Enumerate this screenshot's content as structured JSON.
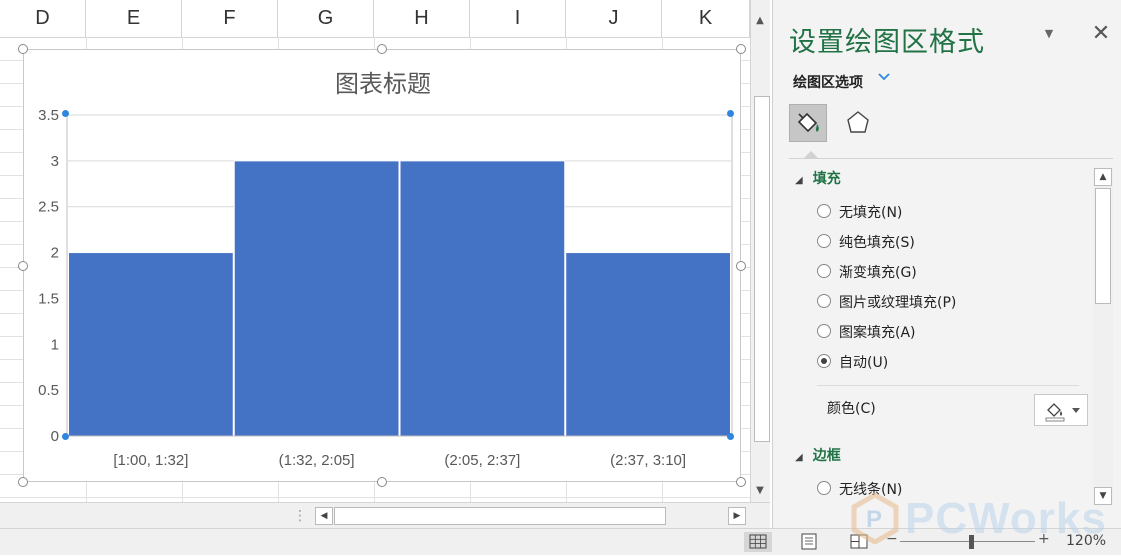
{
  "sheet": {
    "columns": [
      "D",
      "E",
      "F",
      "G",
      "H",
      "I",
      "J",
      "K"
    ]
  },
  "chart_data": {
    "type": "bar",
    "title": "图表标题",
    "categories": [
      "[1:00, 1:32]",
      "(1:32, 2:05]",
      "(2:05, 2:37]",
      "(2:37, 3:10]"
    ],
    "values": [
      2,
      3,
      3,
      2
    ],
    "yticks": [
      "0",
      "0.5",
      "1",
      "1.5",
      "2",
      "2.5",
      "3",
      "3.5"
    ],
    "ylim": [
      0,
      3.5
    ],
    "bar_color": "#4472C4",
    "grid": true
  },
  "pane": {
    "title": "设置绘图区格式",
    "options_label": "绘图区选项",
    "fill_section": "填充",
    "fill_options": [
      "无填充(N)",
      "纯色填充(S)",
      "渐变填充(G)",
      "图片或纹理填充(P)",
      "图案填充(A)",
      "自动(U)"
    ],
    "selected_fill": "自动(U)",
    "color_label": "颜色(C)",
    "border_section": "边框",
    "border_options": [
      "无线条(N)"
    ]
  },
  "statusbar": {
    "zoom": "120%"
  },
  "watermark": {
    "text": "PCWorks"
  },
  "colors": {
    "accent": "#217346",
    "bar": "#4472C4",
    "handle": "#2e86de"
  }
}
